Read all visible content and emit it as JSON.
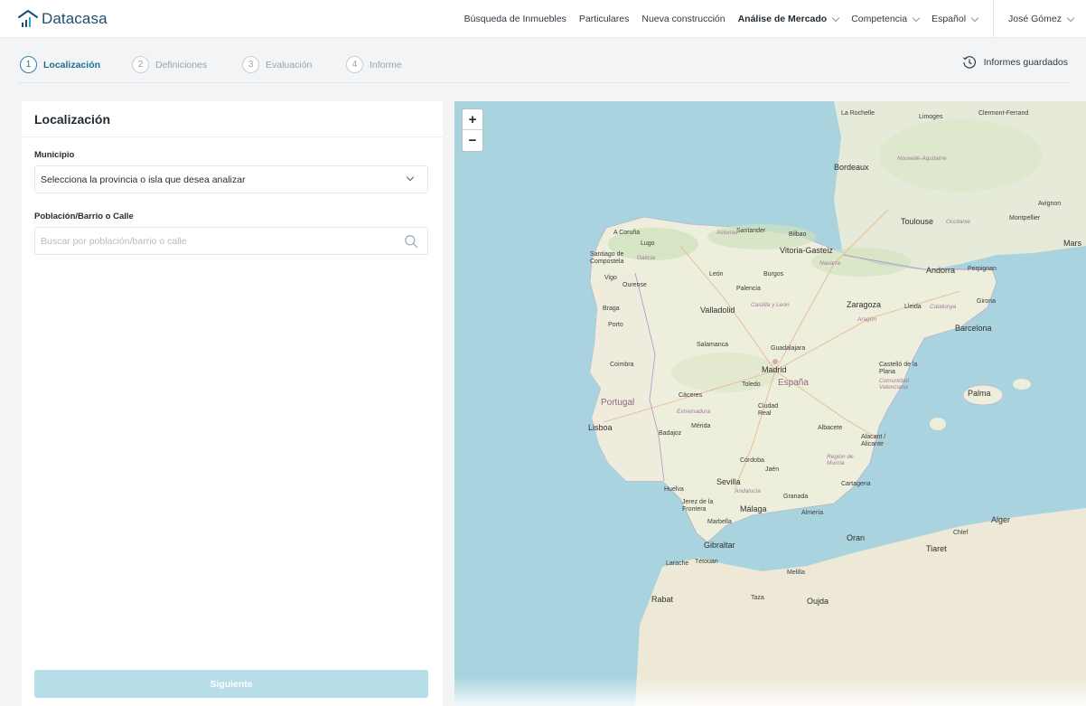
{
  "brand": {
    "name": "Datacasa"
  },
  "nav": {
    "items": [
      {
        "label": "Búsqueda de Inmuebles"
      },
      {
        "label": "Particulares"
      },
      {
        "label": "Nueva construcción"
      },
      {
        "label": "Análise de Mercado"
      },
      {
        "label": "Competencia"
      },
      {
        "label": "Español"
      }
    ],
    "user": "José Gómez"
  },
  "stepper": {
    "steps": [
      {
        "num": "1",
        "label": "Localización"
      },
      {
        "num": "2",
        "label": "Definiciones"
      },
      {
        "num": "3",
        "label": "Evaluación"
      },
      {
        "num": "4",
        "label": "Informe"
      }
    ],
    "active_step": 1,
    "saved_reports": "Informes guardados"
  },
  "panel": {
    "title": "Localización",
    "municipio": {
      "label": "Municipio",
      "value": "Selecciona la provincia o isla que desea analizar"
    },
    "poblacion": {
      "label": "Población/Barrio o Calle",
      "placeholder": "Buscar por población/barrio o calle"
    },
    "next_button": "Siguiente"
  },
  "map": {
    "zoom_in": "+",
    "zoom_out": "−",
    "labels": {
      "la_rochelle": "La Rochelle",
      "limoges": "Limoges",
      "clermont": "Clermont-Ferrand",
      "bordeaux": "Bordeaux",
      "toulouse": "Toulouse",
      "montpellier": "Montpellier",
      "marseille": "Mars",
      "avignon": "Avignon",
      "a_coruna": "A Coruña",
      "lugo": "Lugo",
      "santiago": "Santiago de Compostela",
      "santander": "Santander",
      "bilbao": "Bilbao",
      "vitoria": "Vitoria-Gasteiz",
      "vigo": "Vigo",
      "ourense": "Ourense",
      "leon": "León",
      "burgos": "Burgos",
      "andorra": "Andorra",
      "perpignan": "Perpignan",
      "palencia": "Palencia",
      "braga": "Braga",
      "porto": "Porto",
      "valladolid": "Valladolid",
      "zaragoza": "Zaragoza",
      "lleida": "Lleida",
      "girona": "Girona",
      "barcelona": "Barcelona",
      "salamanca": "Salamanca",
      "guadalajara": "Guadalajara",
      "madrid": "Madrid",
      "espana": "España",
      "coimbra": "Coimbra",
      "toledo": "Toledo",
      "castello": "Castelló de la Plana",
      "caceres": "Cáceres",
      "portugal": "Portugal",
      "ciudad_real": "Ciudad Real",
      "palma": "Palma",
      "lisboa": "Lisboa",
      "merida": "Mérida",
      "badajoz": "Badajoz",
      "albacete": "Albacete",
      "alacant": "Alacant / Alicante",
      "cordoba": "Córdoba",
      "jaen": "Jaén",
      "sevilla": "Sevilla",
      "huelva": "Huelva",
      "granada": "Granada",
      "cartagena": "Cartagena",
      "jerez": "Jerez de la Frontera",
      "malaga": "Málaga",
      "almeria": "Almería",
      "marbella": "Marbella",
      "gibraltar": "Gibraltar",
      "oran": "Oran",
      "alger": "Alger",
      "chlef": "Chlef",
      "tiaret": "Tiaret",
      "rabat": "Rabat",
      "oujda": "Oujda",
      "tetouan": "Tétouan",
      "larache": "Larache",
      "melilla": "Melilla",
      "taza": "Taza",
      "nueva_aquitania": "Nouvelle-Aquitaine",
      "occitanie": "Occitanie",
      "castilla": "Castilla y León",
      "aragon": "Aragón",
      "catalunya": "Catalunya",
      "extremadura": "Extremadura",
      "andalucia": "Andalucía",
      "murcia": "Región de Murcia",
      "valenciana": "Comunidad Valenciana",
      "galicia": "Galicia",
      "asturias": "Asturias",
      "navarra": "Navarra"
    }
  }
}
